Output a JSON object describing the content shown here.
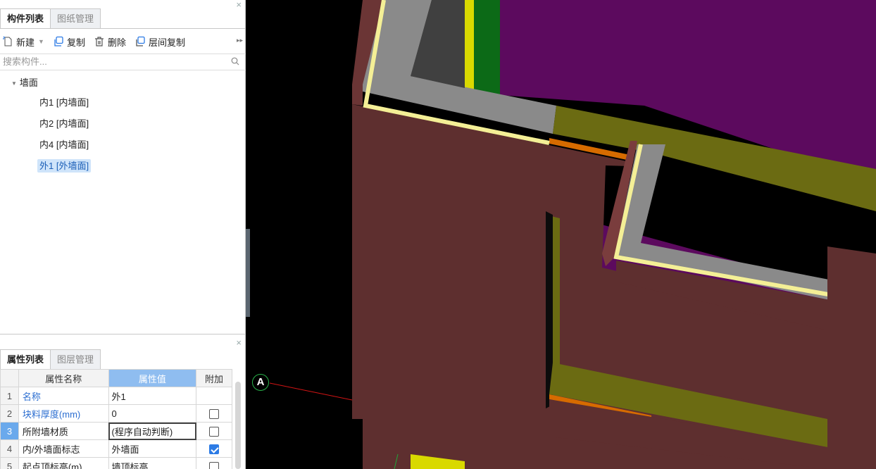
{
  "top_panel": {
    "tabs": [
      {
        "label": "构件列表",
        "active": true
      },
      {
        "label": "图纸管理",
        "active": false
      }
    ],
    "toolbar": {
      "new_label": "新建",
      "copy_label": "复制",
      "delete_label": "删除",
      "floor_copy_label": "层间复制"
    },
    "search_placeholder": "搜索构件...",
    "tree": {
      "root_label": "墙面",
      "items": [
        {
          "label": "内1 [内墙面]"
        },
        {
          "label": "内2 [内墙面]"
        },
        {
          "label": "内4 [内墙面]"
        },
        {
          "label": "外1 [外墙面]",
          "selected": true
        }
      ]
    }
  },
  "bottom_panel": {
    "tabs": [
      {
        "label": "属性列表",
        "active": true
      },
      {
        "label": "图层管理",
        "active": false
      }
    ],
    "columns": [
      "属性名称",
      "属性值",
      "附加"
    ],
    "rows": [
      {
        "num": "1",
        "name": "名称",
        "value": "外1",
        "checkbox": null
      },
      {
        "num": "2",
        "name": "块料厚度(mm)",
        "value": "0",
        "checkbox": false
      },
      {
        "num": "3",
        "name": "所附墙材质",
        "value": "(程序自动判断)",
        "checkbox": false
      },
      {
        "num": "4",
        "name": "内/外墙面标志",
        "value": "外墙面",
        "checkbox": true
      },
      {
        "num": "5",
        "name": "起点顶标高(m)",
        "value": "墙顶标高",
        "checkbox": false
      }
    ]
  },
  "viewport": {
    "axis_label": "A",
    "colors": {
      "background": "#000000",
      "wall": "#6b3535",
      "wall_face": "#5e2f2f",
      "purple": "#5c0a5e",
      "olive": "#6b6b12",
      "gray": "#8a8a8a",
      "yellow_line": "#f4ef96",
      "orange": "#d66b00",
      "yellow_column": "#d9d900",
      "green": "#0c6a17"
    }
  }
}
